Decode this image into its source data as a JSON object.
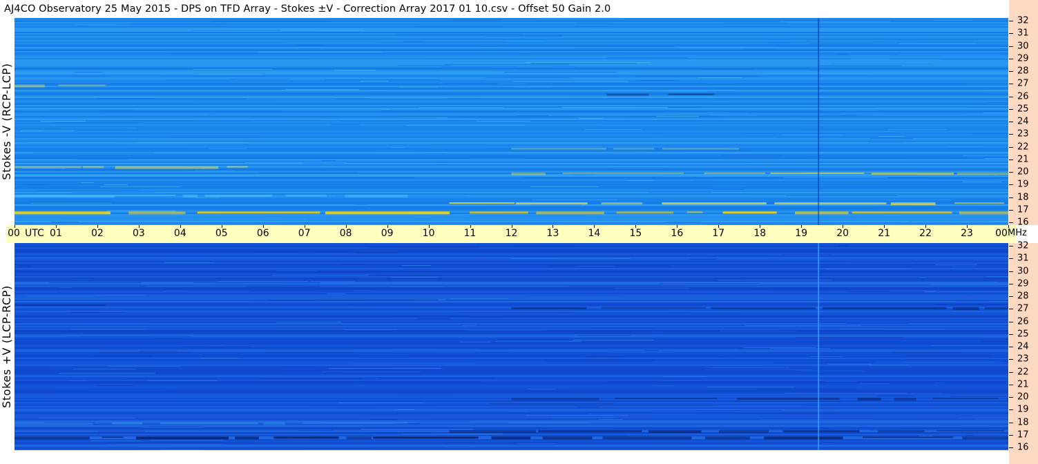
{
  "title": "AJ4CO Observatory  25 May 2015  -  DPS on TFD Array  -  Stokes ±V  -  Correction Array 2017 01 10.csv  -  Offset 50  Gain 2.0",
  "time_axis": {
    "labels": [
      "00",
      "01",
      "02",
      "03",
      "04",
      "05",
      "06",
      "07",
      "08",
      "09",
      "10",
      "11",
      "12",
      "13",
      "14",
      "15",
      "16",
      "17",
      "18",
      "19",
      "20",
      "21",
      "22",
      "23",
      "00"
    ],
    "utc_label": "UTC",
    "unit_label": "MHz"
  },
  "colors": {
    "top_panel_base": "#1a86ec",
    "bottom_panel_base": "#1150d6",
    "time_bar": "#ffffc0",
    "freq_axis_bg": "#fdd9c2"
  },
  "chart_data": [
    {
      "type": "heatmap",
      "panel": "top",
      "ylabel": "Stokes -V (RCP-LCP)",
      "x_range_utc_hours": [
        0,
        24
      ],
      "y_range_mhz": [
        16,
        32
      ],
      "y_ticks": [
        "32",
        "31",
        "30",
        "29",
        "28",
        "27",
        "26",
        "25",
        "24",
        "23",
        "22",
        "21",
        "20",
        "19",
        "18",
        "17",
        "16"
      ],
      "features": [
        {
          "kind": "band",
          "mhz": 17.0,
          "t_start": 0,
          "t_end": 24,
          "color": "#ffd400",
          "intensity": 0.9
        },
        {
          "kind": "band",
          "mhz": 17.7,
          "t_start": 10.5,
          "t_end": 23.9,
          "color": "#f7e83a",
          "intensity": 0.8
        },
        {
          "kind": "band",
          "mhz": 18.3,
          "t_start": 0,
          "t_end": 9.5,
          "color": "#64d9ff",
          "intensity": 0.5
        },
        {
          "kind": "band",
          "mhz": 20.5,
          "t_start": 0,
          "t_end": 5.8,
          "color": "#f7e83a",
          "intensity": 0.6
        },
        {
          "kind": "band",
          "mhz": 20.0,
          "t_start": 12,
          "t_end": 24,
          "color": "#f7e83a",
          "intensity": 0.6
        },
        {
          "kind": "band",
          "mhz": 21.9,
          "t_start": 12,
          "t_end": 17.5,
          "color": "#aef08c",
          "intensity": 0.5
        },
        {
          "kind": "band",
          "mhz": 26.8,
          "t_start": 0,
          "t_end": 2.2,
          "color": "#f7e83a",
          "intensity": 0.6
        },
        {
          "kind": "band",
          "mhz": 26.1,
          "t_start": 14.3,
          "t_end": 16.9,
          "color": "#0a1f6e",
          "intensity": 0.7
        },
        {
          "kind": "vline",
          "utc": 19.4,
          "color": "#0b46b8",
          "intensity": 0.7
        }
      ]
    },
    {
      "type": "heatmap",
      "panel": "bottom",
      "ylabel": "Stokes +V (LCP-RCP)",
      "x_range_utc_hours": [
        0,
        24
      ],
      "y_range_mhz": [
        16,
        32
      ],
      "y_ticks": [
        "32",
        "31",
        "30",
        "29",
        "28",
        "27",
        "26",
        "25",
        "24",
        "23",
        "22",
        "21",
        "20",
        "19",
        "18",
        "17",
        "16"
      ],
      "features": [
        {
          "kind": "band",
          "mhz": 17.0,
          "t_start": 0,
          "t_end": 24,
          "color": "#0a1f6e",
          "intensity": 0.9
        },
        {
          "kind": "band",
          "mhz": 17.5,
          "t_start": 10.5,
          "t_end": 23.9,
          "color": "#0a1f6e",
          "intensity": 0.8
        },
        {
          "kind": "band",
          "mhz": 18.1,
          "t_start": 0,
          "t_end": 9.5,
          "color": "#3aa0f0",
          "intensity": 0.5
        },
        {
          "kind": "band",
          "mhz": 20.0,
          "t_start": 12,
          "t_end": 24,
          "color": "#0a1f6e",
          "intensity": 0.6
        },
        {
          "kind": "band",
          "mhz": 27.2,
          "t_start": 0,
          "t_end": 2.2,
          "color": "#0a1f6e",
          "intensity": 0.6
        },
        {
          "kind": "band",
          "mhz": 27.0,
          "t_start": 12,
          "t_end": 24,
          "color": "#0a1f6e",
          "intensity": 0.6
        },
        {
          "kind": "vline",
          "utc": 19.4,
          "color": "#3aa6f2",
          "intensity": 0.7
        }
      ]
    }
  ]
}
